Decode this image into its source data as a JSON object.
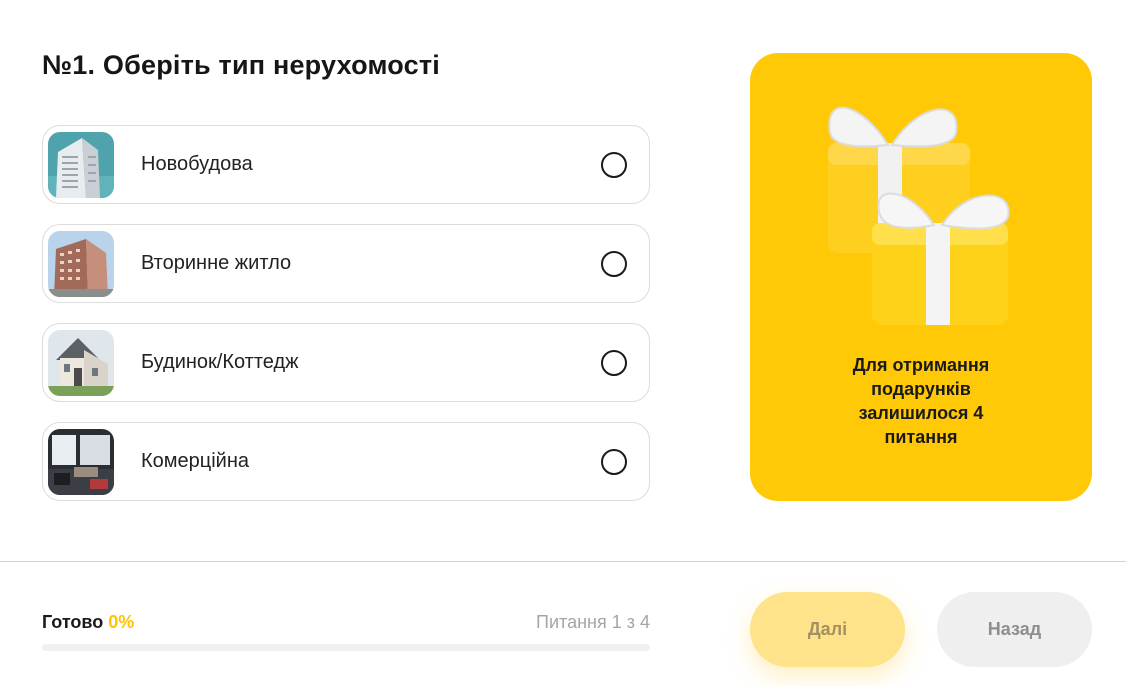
{
  "question": {
    "title": "№1. Оберіть тип нерухомості"
  },
  "options": [
    {
      "label": "Новобудова",
      "image": "new-building-photo"
    },
    {
      "label": "Вторинне житло",
      "image": "secondary-housing-photo"
    },
    {
      "label": "Будинок/Коттедж",
      "image": "house-cottage-photo"
    },
    {
      "label": "Комерційна",
      "image": "commercial-office-photo"
    }
  ],
  "gift_card": {
    "text": "Для отримання подарунків залишилося 4 питання",
    "icon": "gift-boxes-icon",
    "background": "#ffc907"
  },
  "footer": {
    "ready_label": "Готово",
    "ready_percent": "0%",
    "question_counter": "Питання 1 з 4",
    "progress_fraction": 0,
    "next_label": "Далі",
    "back_label": "Назад"
  },
  "colors": {
    "accent": "#ffc400"
  }
}
